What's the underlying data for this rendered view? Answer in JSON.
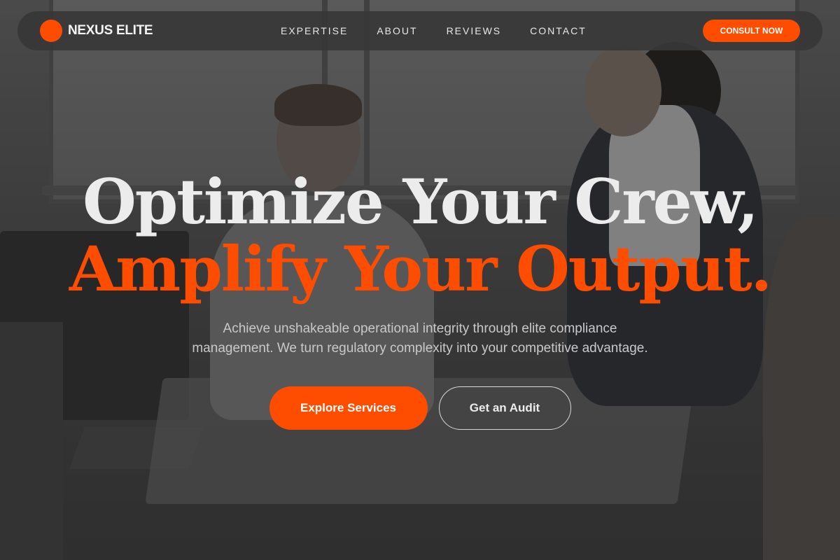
{
  "brand": {
    "name": "NEXUS ELITE",
    "accent_color": "#ff4d00"
  },
  "nav": {
    "links": [
      "EXPERTISE",
      "ABOUT",
      "REVIEWS",
      "CONTACT"
    ],
    "cta_label": "CONSULT NOW"
  },
  "hero": {
    "headline_line1": "Optimize Your Crew,",
    "headline_line2": "Amplify Your Output.",
    "subtext": "Achieve unshakeable operational integrity through elite compliance management. We turn regulatory complexity into your competitive advantage.",
    "primary_button": "Explore Services",
    "secondary_button": "Get an Audit"
  }
}
